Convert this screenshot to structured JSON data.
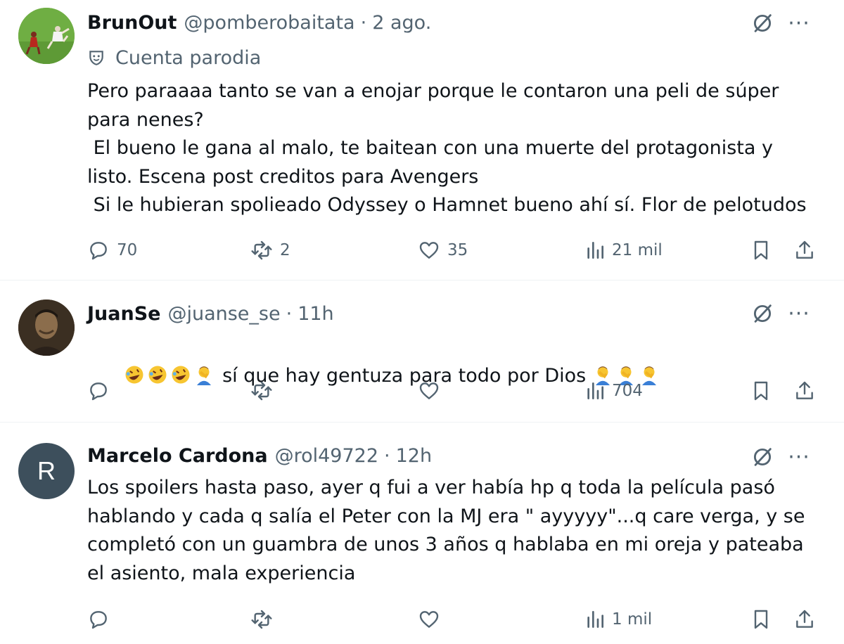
{
  "tweets": [
    {
      "name": "BrunOut",
      "handle": "@pomberobaitata",
      "separator": "·",
      "time": "2 ago.",
      "parody_label": "Cuenta parodia",
      "text": "Pero paraaaa tanto se van a enojar porque le contaron una peli de súper\npara nenes?\n El bueno le gana al malo, te baitean con una muerte del protagonista y\nlisto. Escena post creditos para Avengers\n Si le hubieran spolieado Odyssey o Hamnet bueno ahí sí. Flor de pelotudos",
      "replies": "70",
      "reposts": "2",
      "likes": "35",
      "views": "21 mil",
      "more": "···"
    },
    {
      "name": "JuanSe",
      "handle": "@juanse_se",
      "separator": "·",
      "time": "11h",
      "text_prefix_emoji": [
        "rofl",
        "rofl",
        "rofl",
        "man-facepalming"
      ],
      "text": " sí que hay gentuza para todo por Dios ",
      "text_suffix_emoji": [
        "man-facepalming",
        "man-facepalming",
        "man-facepalming"
      ],
      "replies": "",
      "reposts": "",
      "likes": "",
      "views": "704",
      "more": "···"
    },
    {
      "name": "Marcelo Cardona",
      "handle": "@rol49722",
      "separator": "·",
      "time": "12h",
      "avatar_letter": "R",
      "text": "Los spoilers hasta paso, ayer q fui a ver había hp q toda la película pasó\nhablando y cada q salía el Peter con la MJ era \" ayyyyy\"...q care verga, y se\ncompletó con un guambra de unos 3 años q hablaba en mi oreja y pateaba\nel asiento, mala experiencia",
      "replies": "",
      "reposts": "",
      "likes": "",
      "views": "1 mil",
      "more": "···"
    }
  ],
  "colors": {
    "text": "#0f1419",
    "secondary": "#536471",
    "divider": "#eff3f4",
    "avatar_letter_bg": "#3d4f5c"
  },
  "icons": [
    "reply-icon",
    "repost-icon",
    "like-icon",
    "views-icon",
    "bookmark-icon",
    "share-icon",
    "grok-icon",
    "more-icon",
    "parody-mask-icon"
  ]
}
